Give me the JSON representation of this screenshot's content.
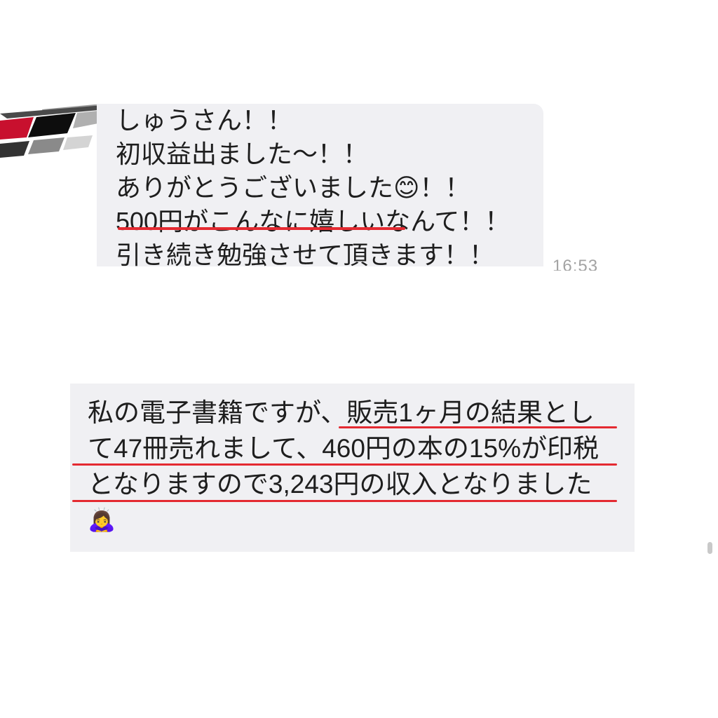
{
  "top_message": {
    "lines": [
      {
        "text": "しゅうさん！！"
      },
      {
        "text": "初収益出ました〜！！"
      },
      {
        "before": "ありがとうございました",
        "emoji": "😊",
        "after": "！！"
      },
      {
        "highlighted": "500円がこんなに嬉しい",
        "after": "なんて！！"
      },
      {
        "text": "引き続き勉強させて頂きます！！"
      }
    ],
    "timestamp": "16:53"
  },
  "bottom_message": {
    "lines": [
      {
        "before": "私の電子書籍ですが、",
        "highlighted": "販売1ヶ月の結果とし"
      },
      {
        "highlighted": "て47冊売れまして、460円の本の15%が印税"
      },
      {
        "highlighted": "となりますので3,243円の収入となりました"
      }
    ],
    "emoji": "🙇‍♀️"
  },
  "colors": {
    "bubble": "#f0f0f3",
    "underline": "#e42a31",
    "text": "#1e1e1e",
    "timestamp": "#a3a3a3"
  },
  "icons": {
    "avatar": "user-avatar",
    "scrollbar": "scrollbar-thumb"
  }
}
